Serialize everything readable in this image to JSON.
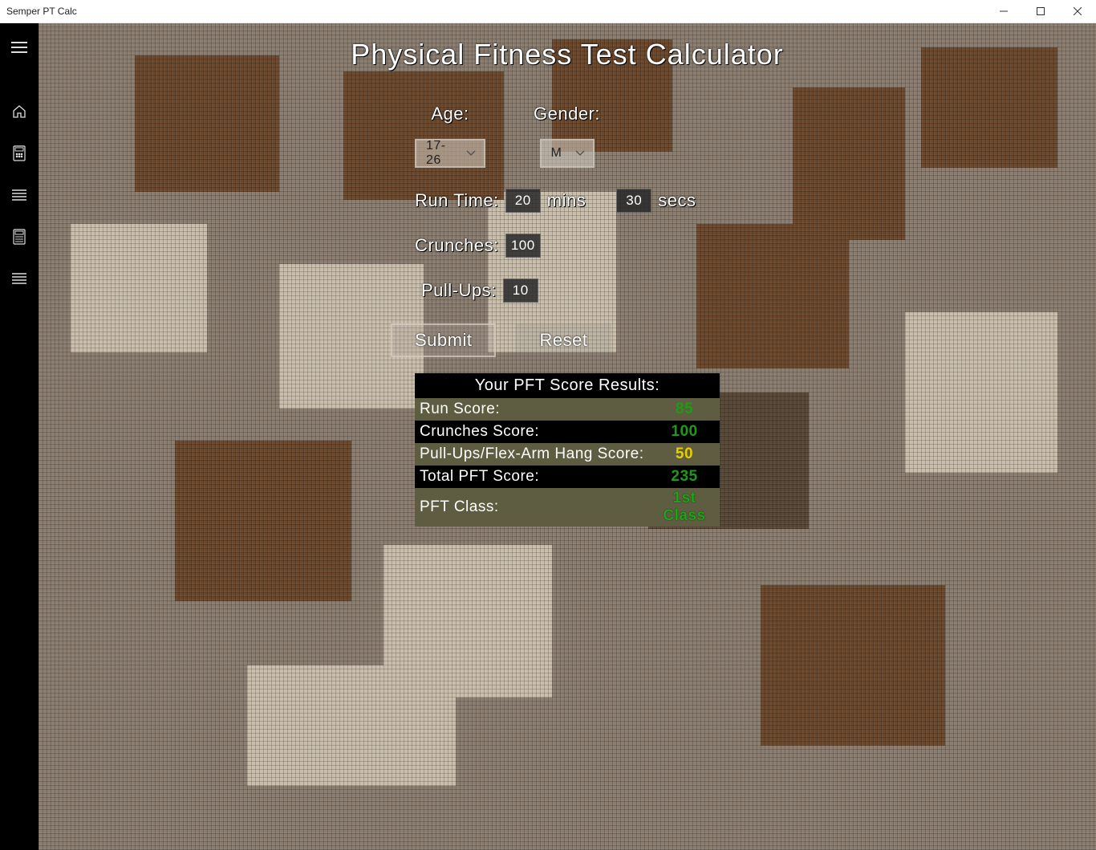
{
  "window": {
    "title": "Semper PT Calc"
  },
  "sidebar": {
    "items": [
      {
        "name": "menu",
        "icon": "menu-icon"
      },
      {
        "name": "home",
        "icon": "home-icon"
      },
      {
        "name": "calc1",
        "icon": "calculator-icon"
      },
      {
        "name": "list1",
        "icon": "list-icon"
      },
      {
        "name": "calc2",
        "icon": "calculator2-icon"
      },
      {
        "name": "list2",
        "icon": "list-icon"
      }
    ]
  },
  "heading": "Physical Fitness Test Calculator",
  "form": {
    "age": {
      "label": "Age:",
      "value": "17-26"
    },
    "gender": {
      "label": "Gender:",
      "value": "M"
    },
    "run": {
      "label": "Run Time:",
      "mins": "20",
      "mins_unit": "mins",
      "secs": "30",
      "secs_unit": "secs"
    },
    "crunches": {
      "label": "Crunches:",
      "value": "100"
    },
    "pullups": {
      "label": "Pull-Ups:",
      "value": "10"
    }
  },
  "buttons": {
    "submit": "Submit",
    "reset": "Reset"
  },
  "results": {
    "caption": "Your PFT Score Results:",
    "rows": [
      {
        "label": "Run Score:",
        "value": "85",
        "vclass": "v-green",
        "rowclass": "row-olive"
      },
      {
        "label": "Crunches Score:",
        "value": "100",
        "vclass": "v-green",
        "rowclass": "row-black"
      },
      {
        "label": "Pull-Ups/Flex-Arm Hang Score:",
        "value": "50",
        "vclass": "v-yellow",
        "rowclass": "row-olive"
      },
      {
        "label": "Total PFT Score:",
        "value": "235",
        "vclass": "v-green",
        "rowclass": "row-black"
      },
      {
        "label": "PFT Class:",
        "value": "1st Class",
        "vclass": "v-green-bold",
        "rowclass": "row-olive"
      }
    ]
  },
  "colors": {
    "green": "#1f9a18",
    "yellow": "#e5cf00"
  }
}
